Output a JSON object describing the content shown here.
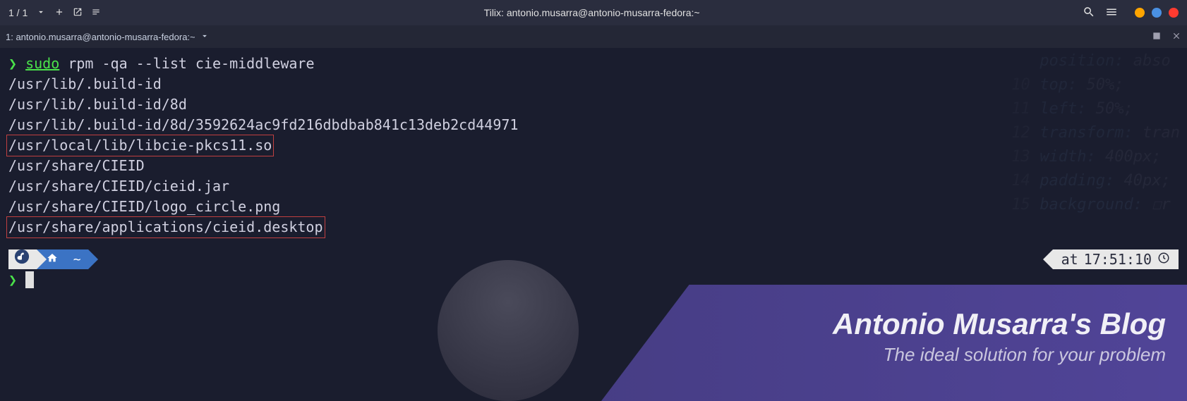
{
  "titlebar": {
    "session_counter": "1 / 1",
    "title": "Tilix: antonio.musarra@antonio-musarra-fedora:~"
  },
  "tabbar": {
    "tab_label": "1: antonio.musarra@antonio-musarra-fedora:~"
  },
  "terminal": {
    "prompt": "❯",
    "sudo": "sudo",
    "command": "rpm",
    "args": "-qa --list cie-middleware",
    "output": [
      "/usr/lib/.build-id",
      "/usr/lib/.build-id/8d",
      "/usr/lib/.build-id/8d/3592624ac9fd216dbdbab841c13deb2cd44971",
      "/usr/local/lib/libcie-pkcs11.so",
      "/usr/share/CIEID",
      "/usr/share/CIEID/cieid.jar",
      "/usr/share/CIEID/logo_circle.png",
      "/usr/share/applications/cieid.desktop"
    ],
    "highlighted_indices": [
      3,
      7
    ],
    "home_path": "~",
    "timestamp_prefix": "at",
    "timestamp": "17:51:10"
  },
  "blog": {
    "title": "Antonio Musarra's Blog",
    "subtitle": "The ideal solution for your problem"
  },
  "bg_code": [
    {
      "n": "",
      "prop": "position:",
      "val": "abso"
    },
    {
      "n": "10",
      "prop": "top:",
      "val": "50%;"
    },
    {
      "n": "11",
      "prop": "left:",
      "val": "50%;"
    },
    {
      "n": "12",
      "prop": "transform:",
      "val": "tran"
    },
    {
      "n": "13",
      "prop": "width:",
      "val": "400px;"
    },
    {
      "n": "14",
      "prop": "padding:",
      "val": "40px;"
    },
    {
      "n": "15",
      "prop": "background:",
      "val": "☐r"
    }
  ]
}
